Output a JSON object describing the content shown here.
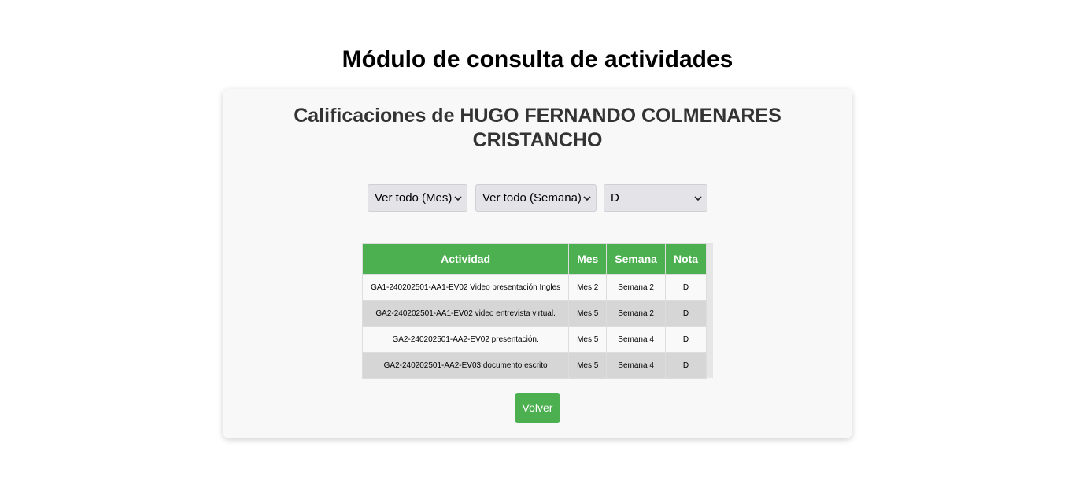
{
  "page": {
    "title": "Módulo de consulta de actividades"
  },
  "card": {
    "title_line1": "Calificaciones de HUGO FERNANDO COLMENARES",
    "title_line2": "CRISTANCHO"
  },
  "filters": {
    "mes": {
      "selected": "Ver todo (Mes)"
    },
    "semana": {
      "selected": "Ver todo (Semana)"
    },
    "nota": {
      "selected": "D"
    }
  },
  "table": {
    "headers": [
      "Actividad",
      "Mes",
      "Semana",
      "Nota"
    ],
    "rows": [
      [
        "GA1-240202501-AA1-EV02 Video presentación Ingles",
        "Mes 2",
        "Semana 2",
        "D"
      ],
      [
        "GA2-240202501-AA1-EV02 video entrevista virtual.",
        "Mes 5",
        "Semana 2",
        "D"
      ],
      [
        "GA2-240202501-AA2-EV02 presentación.",
        "Mes 5",
        "Semana 4",
        "D"
      ],
      [
        "GA2-240202501-AA2-EV03 documento escrito",
        "Mes 5",
        "Semana 4",
        "D"
      ]
    ]
  },
  "actions": {
    "back_label": "Volver"
  },
  "colors": {
    "accent": "#4caf50",
    "card_bg": "#f8f8f8",
    "row_alt": "#d6d6d6"
  },
  "icons": {
    "dropdown": "chevron-down-icon"
  }
}
